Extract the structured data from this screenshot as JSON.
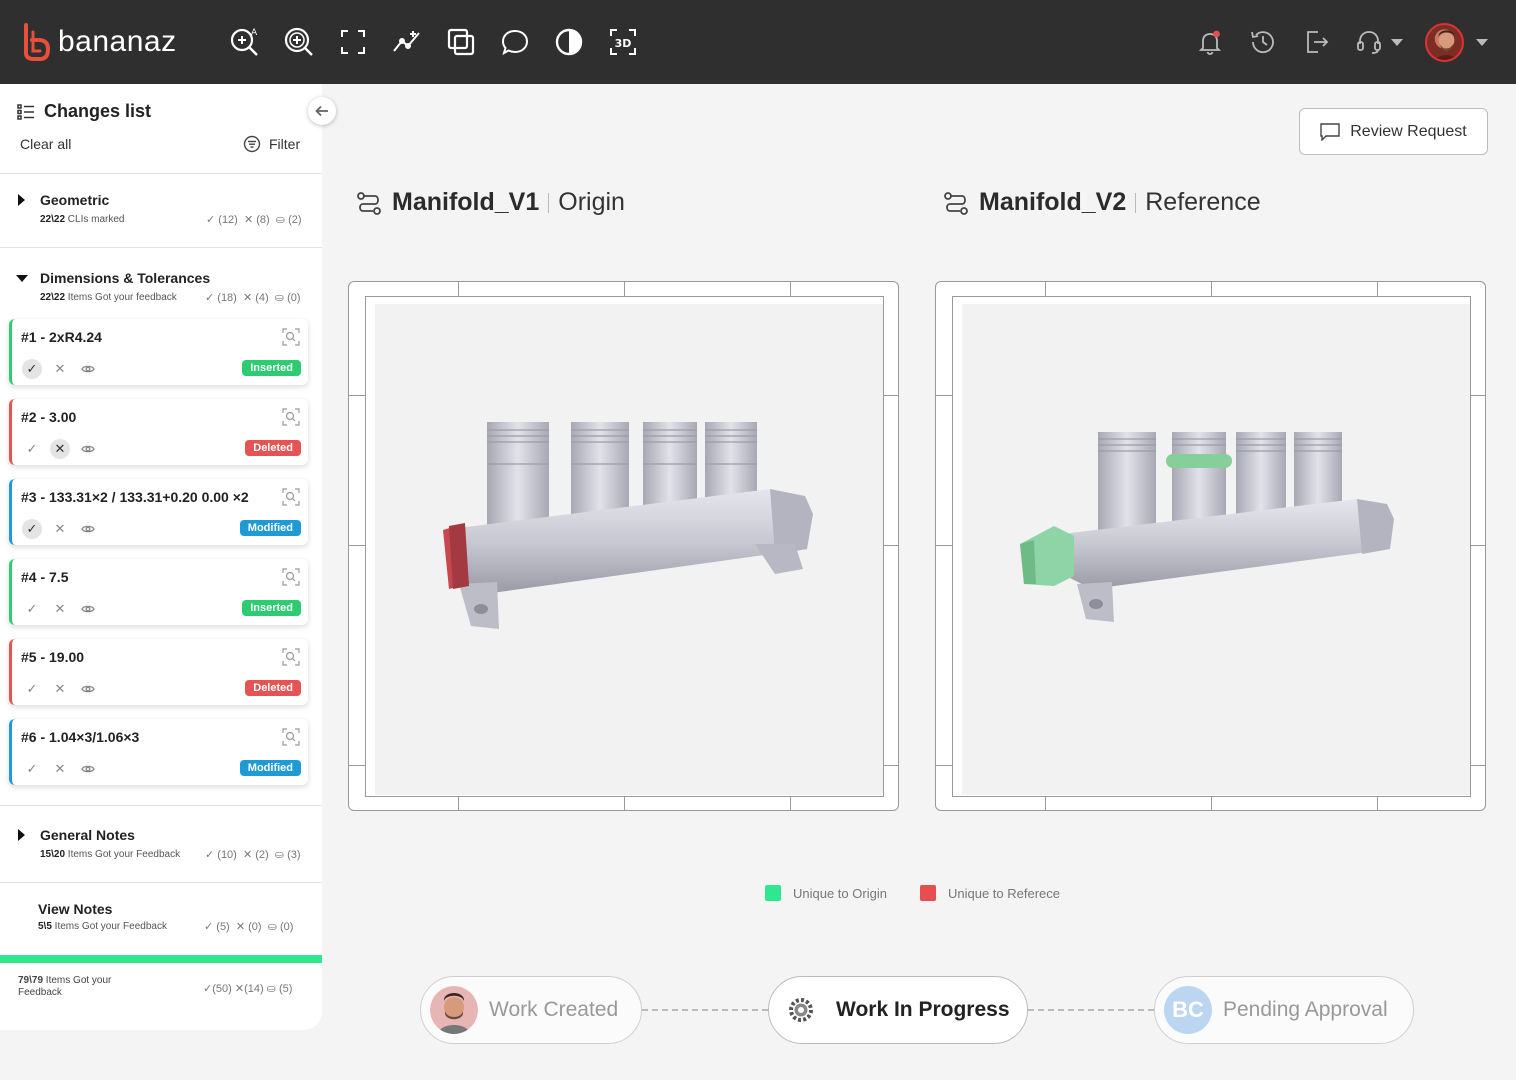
{
  "app": {
    "name": "bananaz"
  },
  "toolbar": {
    "tools": [
      "zoom-annotation-icon",
      "zoom-in-icon",
      "fit-screen-icon",
      "measure-icon",
      "overlay-icon",
      "comment-icon",
      "contrast-icon",
      "3d-view-icon"
    ],
    "three_d_label": "3D"
  },
  "sidebar": {
    "title": "Changes list",
    "clear_all": "Clear all",
    "filter": "Filter",
    "groups": [
      {
        "title": "Geometric",
        "count": "22\\22",
        "sub": " CLIs marked",
        "ok": "(12)",
        "x": "(8)",
        "pending": "(2)"
      },
      {
        "title": "Dimensions & Tolerances",
        "count": "22\\22",
        "sub": " Items Got your feedback",
        "ok": "(18)",
        "x": "(4)",
        "pending": "(0)"
      },
      {
        "title": "General Notes",
        "count": "15\\20",
        "sub": " Items Got your Feedback",
        "ok": "(10)",
        "x": "(2)",
        "pending": "(3)"
      },
      {
        "title": "View Notes",
        "count": "5\\5",
        "sub": " Items Got your Feedback",
        "ok": "(5)",
        "x": "(0)",
        "pending": "(0)"
      }
    ],
    "items": [
      {
        "title": "#1 - 2xR4.24",
        "status": "Inserted"
      },
      {
        "title": "#2 - 3.00",
        "status": "Deleted"
      },
      {
        "title": "#3 - 133.31×2 / 133.31+0.20 0.00 ×2",
        "status": "Modified"
      },
      {
        "title": "#4 - 7.5",
        "status": "Inserted"
      },
      {
        "title": "#5 - 19.00",
        "status": "Deleted"
      },
      {
        "title": "#6 - 1.04×3/1.06×3",
        "status": "Modified"
      }
    ],
    "total": {
      "count": "79\\79",
      "sub": " Items Got your Feedback",
      "ok": "(50)",
      "x": "(14)",
      "pending": "(5)"
    }
  },
  "main": {
    "review_button": "Review Request",
    "origin": {
      "name": "Manifold_V1",
      "role": "Origin"
    },
    "reference": {
      "name": "Manifold_V2",
      "role": "Reference"
    },
    "legend": [
      {
        "label": "Unique to Origin",
        "color": "#2ee88f"
      },
      {
        "label": "Unique to Referece",
        "color": "#e84e4e"
      }
    ]
  },
  "workflow": {
    "steps": [
      {
        "label": "Work Created",
        "state": "done"
      },
      {
        "label": "Work In Progress",
        "state": "active"
      },
      {
        "label": "Pending Approval",
        "state": "pending",
        "initials": "BC"
      }
    ]
  },
  "colors": {
    "topbar": "#2f2f2f",
    "brand_red": "#e8503a",
    "inserted": "#2ecc71",
    "deleted": "#e55353",
    "modified": "#1e9ad6"
  }
}
